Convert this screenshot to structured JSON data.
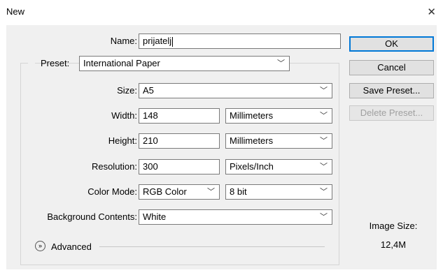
{
  "window": {
    "title": "New",
    "close_glyph": "✕"
  },
  "form": {
    "name_label": "Name:",
    "name_value": "prijatelj",
    "preset_label": "Preset:",
    "preset_value": "International Paper",
    "size_label": "Size:",
    "size_value": "A5",
    "width_label": "Width:",
    "width_value": "148",
    "width_unit": "Millimeters",
    "height_label": "Height:",
    "height_value": "210",
    "height_unit": "Millimeters",
    "resolution_label": "Resolution:",
    "resolution_value": "300",
    "resolution_unit": "Pixels/Inch",
    "color_mode_label": "Color Mode:",
    "color_mode_value": "RGB Color",
    "bit_depth_value": "8 bit",
    "background_label": "Background Contents:",
    "background_value": "White",
    "advanced_label": "Advanced"
  },
  "buttons": {
    "ok": "OK",
    "cancel": "Cancel",
    "save_preset": "Save Preset...",
    "delete_preset": "Delete Preset..."
  },
  "image_size": {
    "label": "Image Size:",
    "value": "12,4M"
  },
  "icons": {
    "dropdown": "chevron-down-icon",
    "advanced": "expand-chevrons-icon",
    "close": "close-icon"
  },
  "colors": {
    "dialog_bg": "#f0f0f0",
    "primary_border": "#0078d7",
    "disabled_text": "#a0a0a0"
  }
}
